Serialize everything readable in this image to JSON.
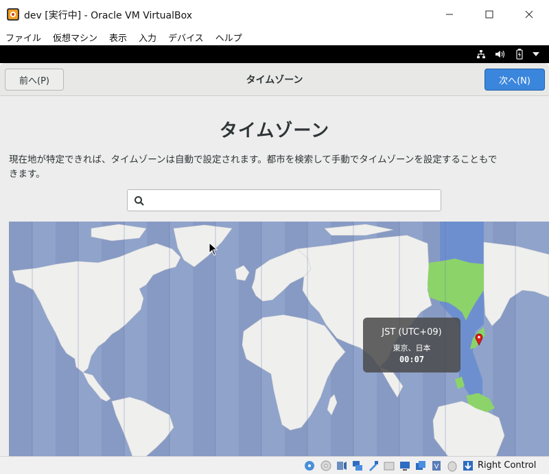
{
  "window": {
    "title": "dev [実行中] - Oracle VM VirtualBox",
    "menu": [
      "ファイル",
      "仮想マシン",
      "表示",
      "入力",
      "デバイス",
      "ヘルプ"
    ]
  },
  "tray_icons": [
    "network-icon",
    "volume-icon",
    "battery-icon",
    "menu-arrow-icon"
  ],
  "installer": {
    "prev_button": "前へ(P)",
    "header_title": "タイムゾーン",
    "next_button": "次へ(N)",
    "page_heading": "タイムゾーン",
    "description_line1": "現在地が特定できれば、タイムゾーンは自動で設定されます。都市を検索して手動でタイムゾーンを設定することもで",
    "description_line2": "きます。",
    "search": {
      "value": "",
      "placeholder": ""
    }
  },
  "timezone_popup": {
    "abbreviation": "JST (UTC+09)",
    "location": "東京、日本",
    "local_time": "00:07"
  },
  "colors": {
    "ocean": "#8fa3cb",
    "land": "#efefee",
    "highlight_zone": "#6d8fcf",
    "highlight_land": "#8cd36a",
    "next_button": "#3b86dd",
    "pin": "#e0191c"
  },
  "statusbar": {
    "icons": [
      "disk-icon",
      "optical-drive-icon",
      "audio-icon",
      "network-adapter-icon",
      "usb-icon",
      "shared-folder-icon",
      "display-icon",
      "video-capture-icon",
      "cpu-icon",
      "mouse-integration-icon",
      "keyboard-capture-icon"
    ],
    "host_key": "Right Control"
  }
}
